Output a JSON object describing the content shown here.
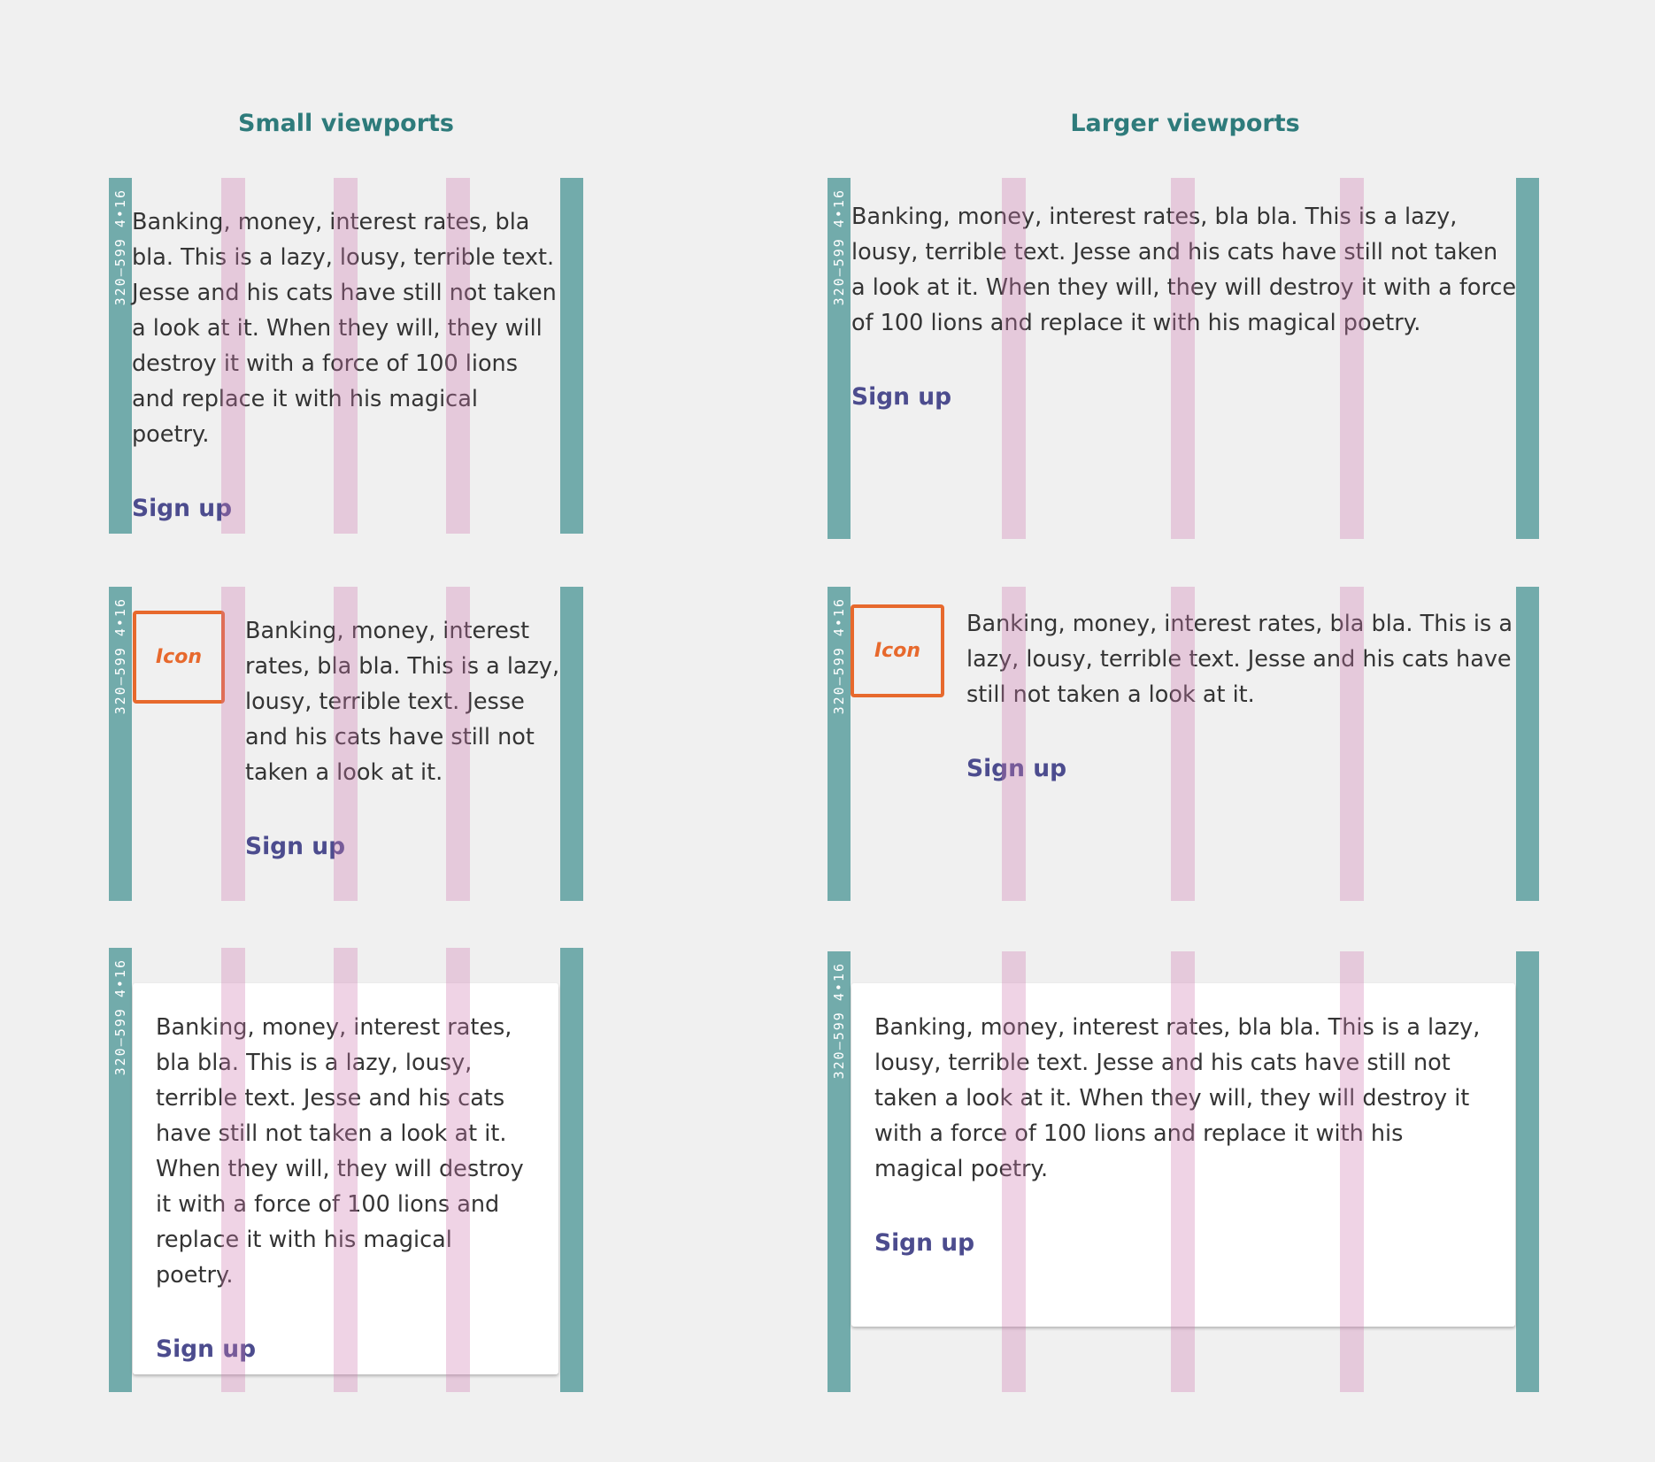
{
  "headings": {
    "small": "Small viewports",
    "large": "Larger viewports"
  },
  "grid_label": "320–599 4•16",
  "body_text": {
    "long": "Banking, money, interest rates, bla bla. This is a lazy, lousy, terrible text. Jesse and his cats have still not taken a look at it. When they will, they will destroy it with a force of 100 lions and replace it with his magical poetry.",
    "short": "Banking, money, interest rates, bla bla. This is a lazy, lousy, terrible text. Jesse and his cats have still not taken a look at it."
  },
  "link_label": "Sign up",
  "icon_label": "Icon",
  "colors": {
    "background": "#f0f0f0",
    "heading": "#2e7b7b",
    "gutter": "#72abab",
    "column": "#dfbdd2",
    "link": "#4c4c8e",
    "icon_border": "#e7692d"
  }
}
